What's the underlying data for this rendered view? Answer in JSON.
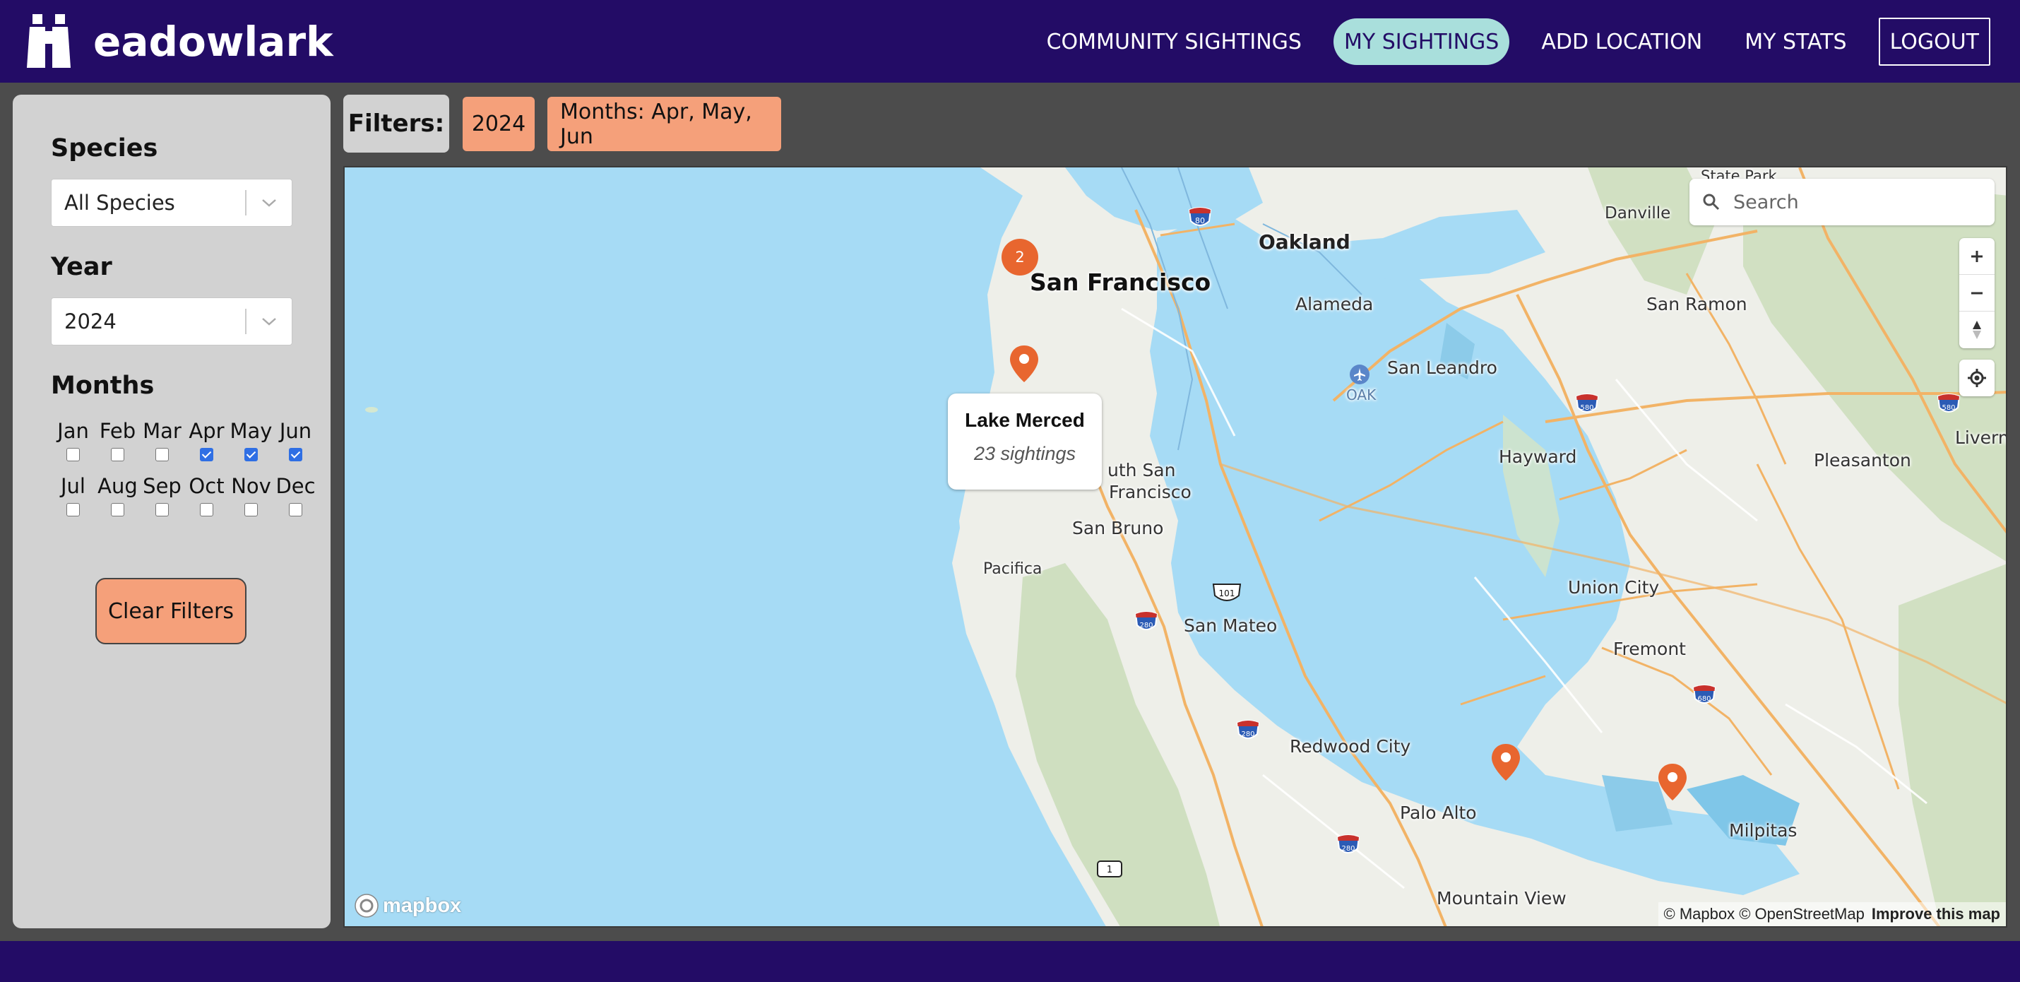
{
  "app": {
    "name": "eadowlark"
  },
  "nav": {
    "items": [
      {
        "label": "COMMUNITY SIGHTINGS",
        "active": false
      },
      {
        "label": "MY SIGHTINGS",
        "active": true
      },
      {
        "label": "ADD LOCATION",
        "active": false
      },
      {
        "label": "MY STATS",
        "active": false
      },
      {
        "label": "LOGOUT",
        "active": false
      }
    ]
  },
  "sidebar": {
    "species": {
      "title": "Species",
      "value": "All Species"
    },
    "year": {
      "title": "Year",
      "value": "2024"
    },
    "months": {
      "title": "Months",
      "items": [
        {
          "label": "Jan",
          "checked": false
        },
        {
          "label": "Feb",
          "checked": false
        },
        {
          "label": "Mar",
          "checked": false
        },
        {
          "label": "Apr",
          "checked": true
        },
        {
          "label": "May",
          "checked": true
        },
        {
          "label": "Jun",
          "checked": true
        },
        {
          "label": "Jul",
          "checked": false
        },
        {
          "label": "Aug",
          "checked": false
        },
        {
          "label": "Sep",
          "checked": false
        },
        {
          "label": "Oct",
          "checked": false
        },
        {
          "label": "Nov",
          "checked": false
        },
        {
          "label": "Dec",
          "checked": false
        }
      ]
    },
    "clear_label": "Clear Filters"
  },
  "filters": {
    "label": "Filters:",
    "chips": [
      "2024",
      "Months: Apr, May, Jun"
    ]
  },
  "map": {
    "search_placeholder": "Search",
    "cluster_count": "2",
    "popup": {
      "title": "Lake Merced",
      "subtitle": "23 sightings"
    },
    "places": {
      "sf": "San Francisco",
      "oakland": "Oakland",
      "alameda": "Alameda",
      "san_leandro": "San Leandro",
      "oak": "OAK",
      "hayward": "Hayward",
      "san_ramon": "San Ramon",
      "danville": "Danville",
      "state_park": "State Park",
      "livermore": "Livermore",
      "pleasanton": "Pleasanton",
      "ssf1": "uth San",
      "ssf2": "Francisco",
      "san_bruno": "San Bruno",
      "pacifica": "Pacifica",
      "union_city": "Union City",
      "fremont": "Fremont",
      "san_mateo": "San Mateo",
      "redwood_city": "Redwood City",
      "palo_alto": "Palo Alto",
      "milpitas": "Milpitas",
      "mountain_view": "Mountain View"
    },
    "shields": {
      "i80": "80",
      "i580a": "580",
      "i580b": "580",
      "i280a": "280",
      "i280b": "280",
      "i280c": "280",
      "i680": "680",
      "us101": "101",
      "sr1": "1"
    },
    "logo": "mapbox",
    "attribution": "© Mapbox © OpenStreetMap",
    "improve": "Improve this map"
  },
  "colors": {
    "navbar": "#230c66",
    "active_pill": "#a9dfdc",
    "accent": "#f5a07a",
    "panel": "#d2d2d2",
    "water": "#a6dbf5",
    "marker": "#e8662f"
  }
}
